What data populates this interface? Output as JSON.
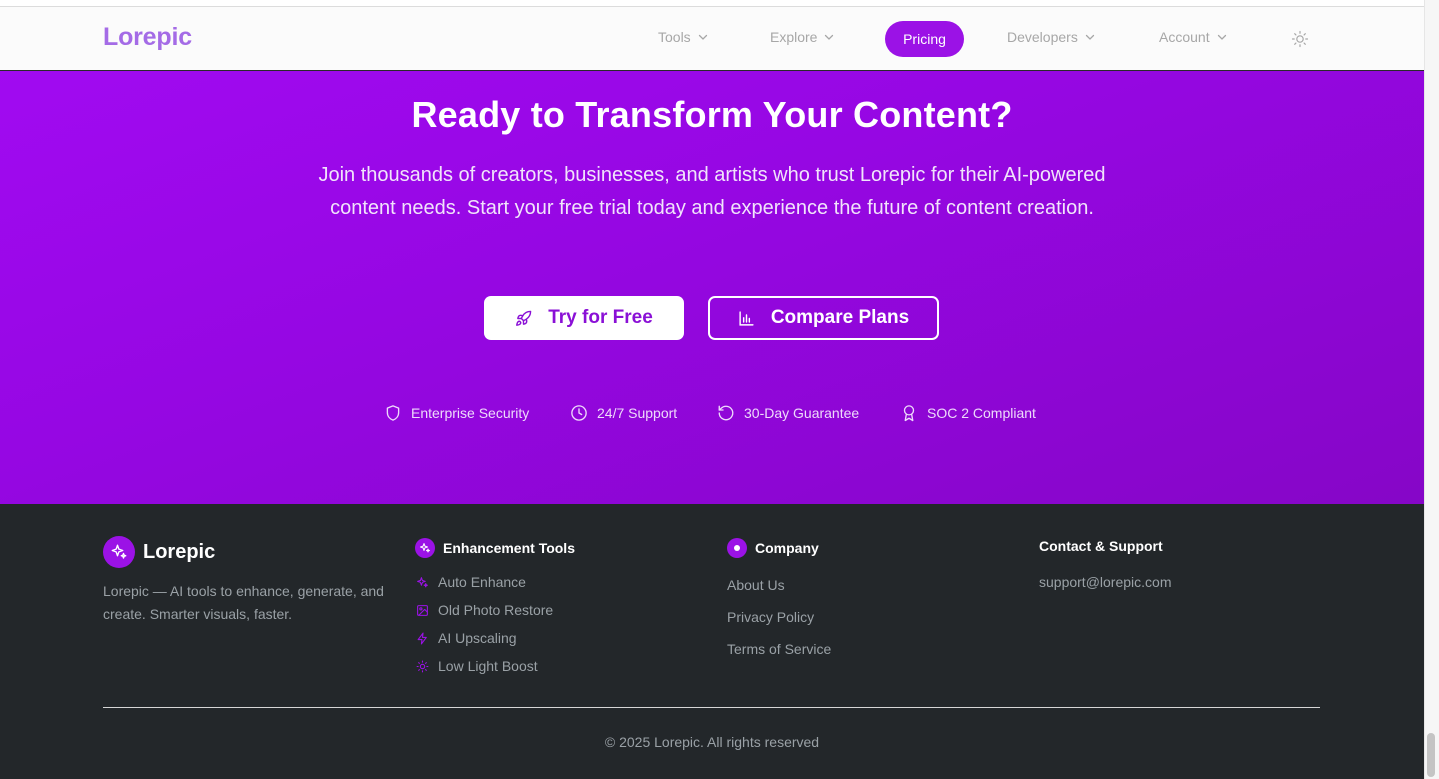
{
  "nav": {
    "logo": "Lorepic",
    "items": [
      {
        "label": "Tools"
      },
      {
        "label": "Explore"
      },
      {
        "label": "Pricing"
      },
      {
        "label": "Developers"
      },
      {
        "label": "Account"
      }
    ]
  },
  "hero": {
    "title": "Ready to Transform Your Content?",
    "description": "Join thousands of creators, businesses, and artists who trust Lorepic for their AI-powered content needs. Start your free trial today and experience the future of content creation.",
    "primary_button": "Try for Free",
    "secondary_button": "Compare Plans",
    "badges": [
      {
        "icon": "shield-icon",
        "label": "Enterprise Security"
      },
      {
        "icon": "clock-icon",
        "label": "24/7 Support"
      },
      {
        "icon": "refresh-icon",
        "label": "30-Day Guarantee"
      },
      {
        "icon": "award-icon",
        "label": "SOC 2 Compliant"
      }
    ]
  },
  "footer": {
    "brand": "Lorepic",
    "description": "Lorepic — AI tools to enhance, generate, and create. Smarter visuals, faster.",
    "enhancement": {
      "title": "Enhancement Tools",
      "links": [
        "Auto Enhance",
        "Old Photo Restore",
        "AI Upscaling",
        "Low Light Boost"
      ]
    },
    "company": {
      "title": "Company",
      "links": [
        "About Us",
        "Privacy Policy",
        "Terms of Service"
      ]
    },
    "contact": {
      "title": "Contact & Support",
      "email": "support@lorepic.com"
    },
    "copyright": "© 2025 Lorepic. All rights reserved"
  },
  "colors": {
    "accent": "#9b12e6",
    "hero_gradient_start": "#a10af1",
    "hero_gradient_end": "#8606c7",
    "footer_bg": "#23272a"
  }
}
